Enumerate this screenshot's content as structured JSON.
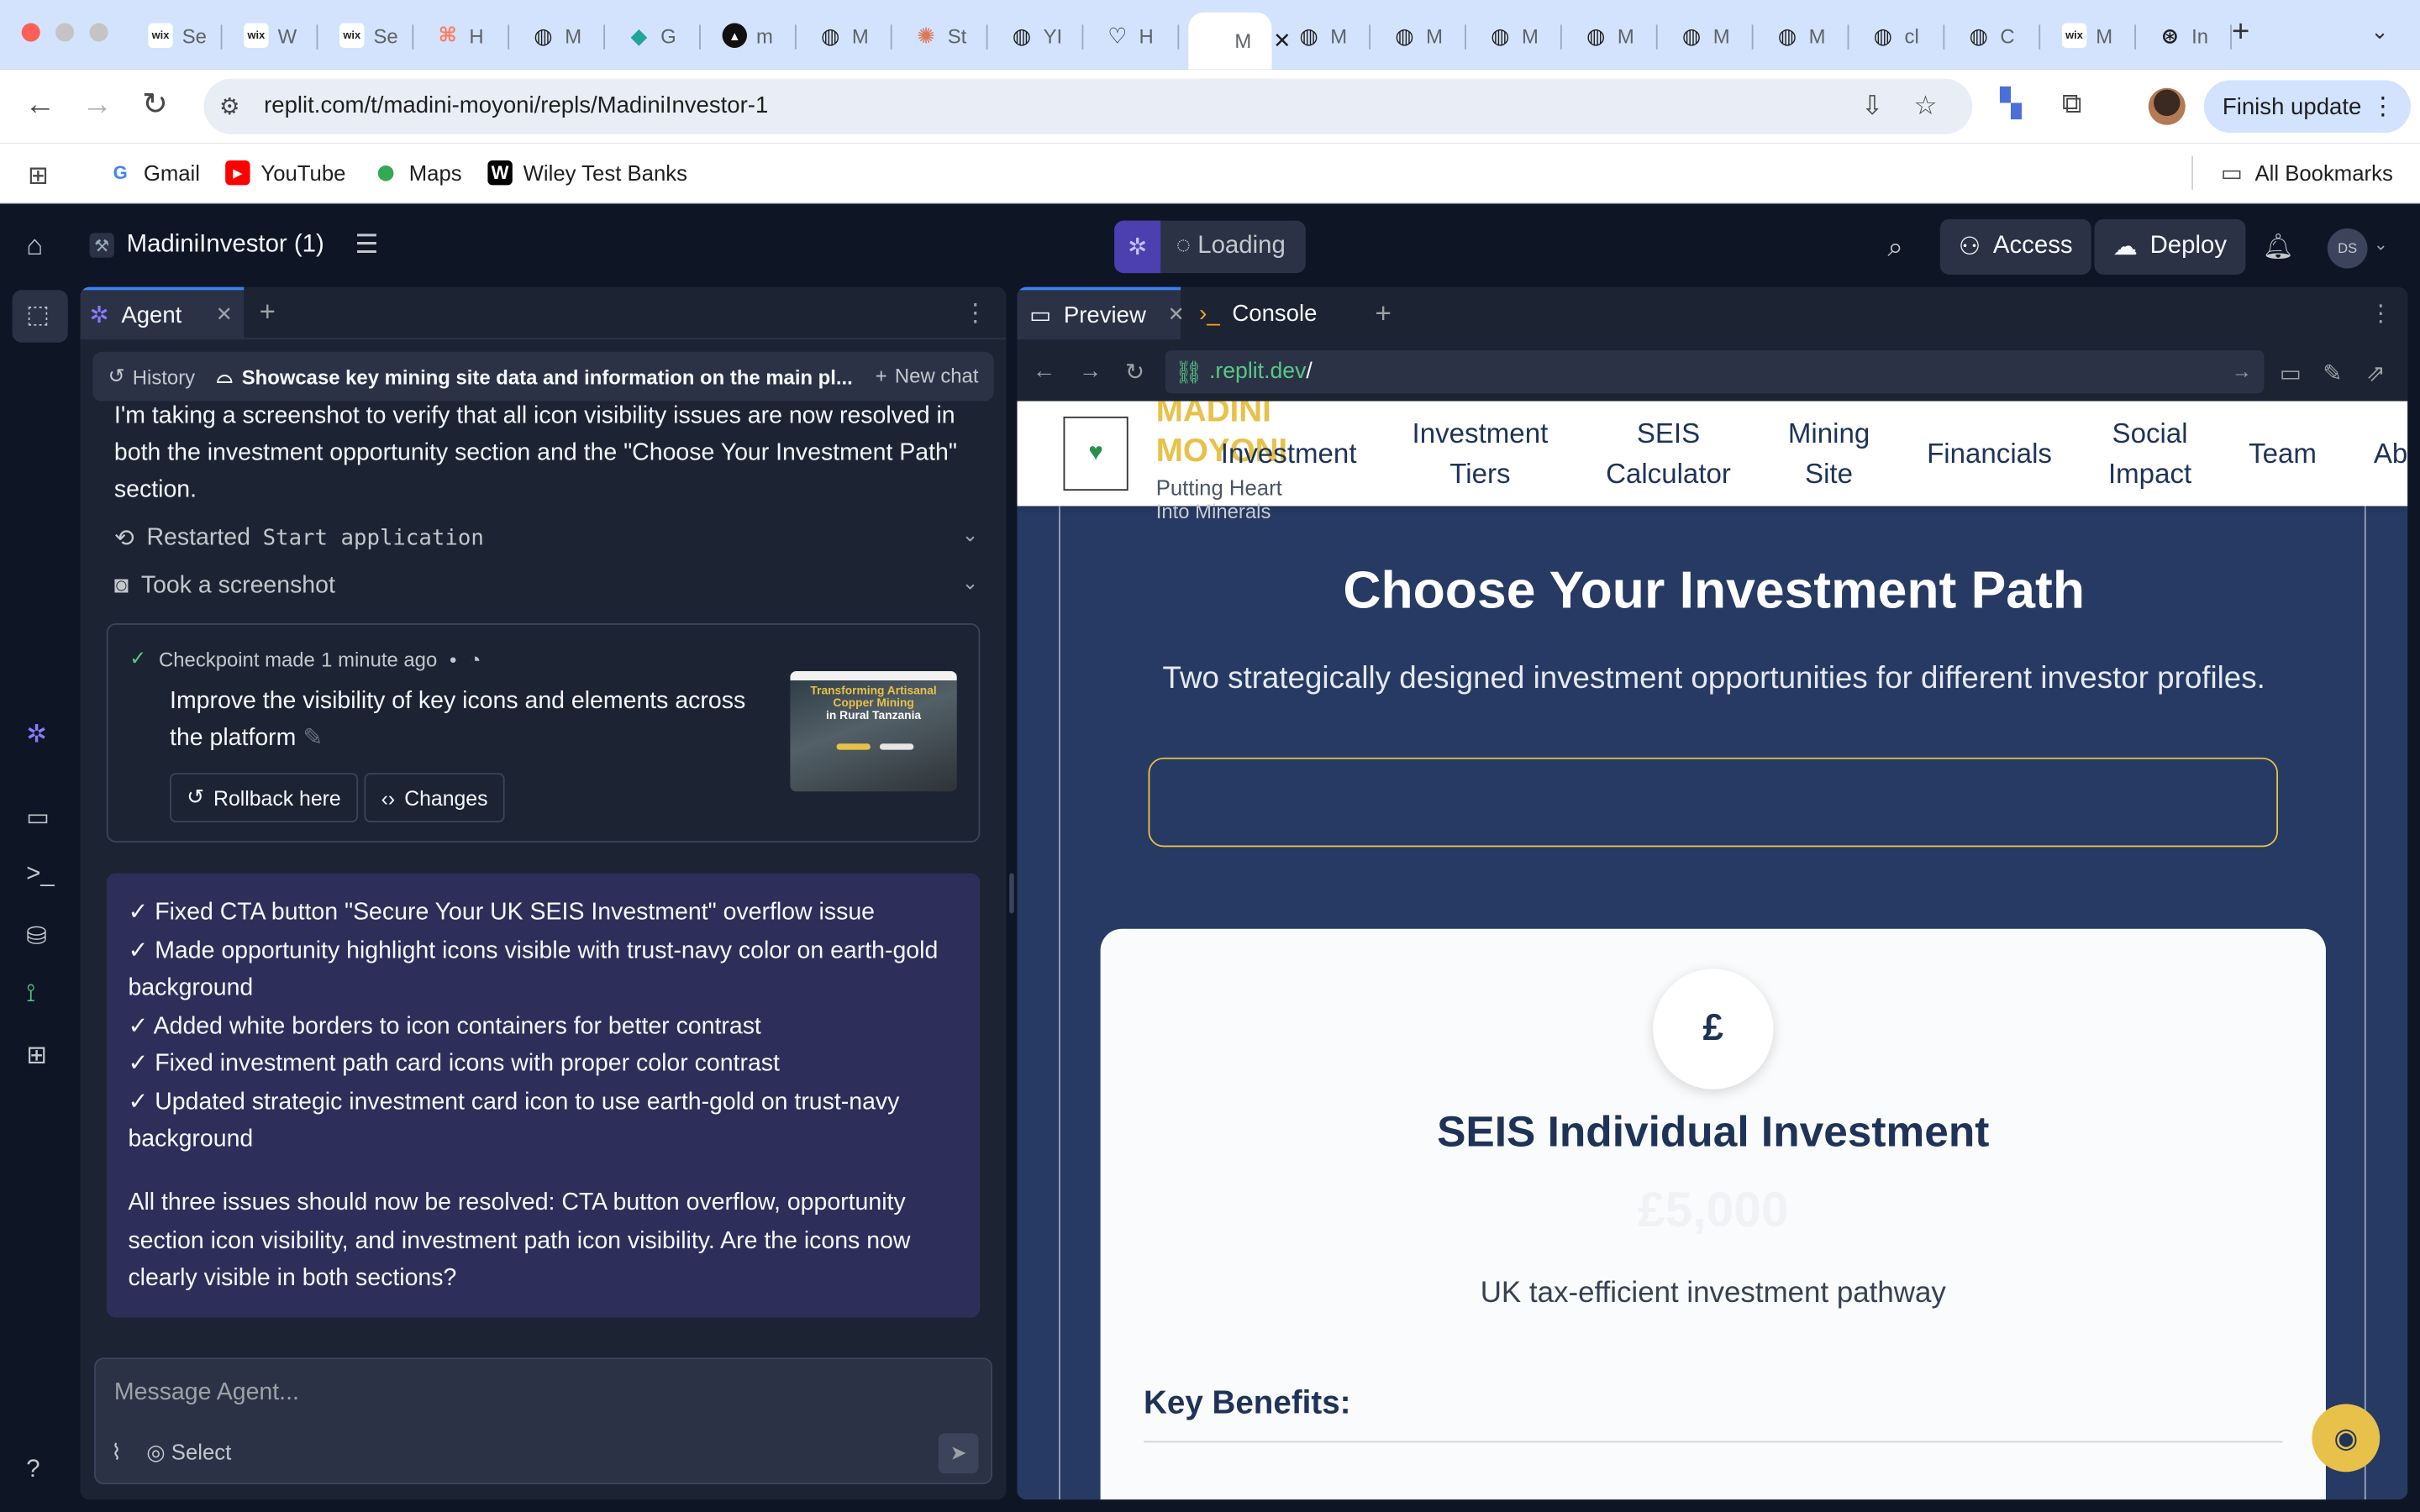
{
  "browser": {
    "tabs": [
      {
        "short": "Se",
        "icon": "wix-icon",
        "glyph": "wix"
      },
      {
        "short": "W",
        "icon": "wix-icon",
        "glyph": "wix"
      },
      {
        "short": "Se",
        "icon": "wix-icon",
        "glyph": "wix"
      },
      {
        "short": "H",
        "icon": "hubspot-icon",
        "glyph": "⌘"
      },
      {
        "short": "M",
        "icon": "globe-icon",
        "glyph": "◍"
      },
      {
        "short": "G",
        "icon": "diamond-icon",
        "glyph": "◆"
      },
      {
        "short": "m",
        "icon": "triangle-icon",
        "glyph": "▲"
      },
      {
        "short": "M",
        "icon": "globe-icon",
        "glyph": "◍"
      },
      {
        "short": "St",
        "icon": "sunburst-icon",
        "glyph": "✺"
      },
      {
        "short": "YI",
        "icon": "globe-icon",
        "glyph": "◍"
      },
      {
        "short": "H",
        "icon": "heart-hands-icon",
        "glyph": "♡"
      },
      {
        "short": "M",
        "icon": "replit-icon",
        "glyph": ""
      },
      {
        "short": "M",
        "icon": "globe-icon",
        "glyph": "◍"
      },
      {
        "short": "M",
        "icon": "globe-icon",
        "glyph": "◍"
      },
      {
        "short": "M",
        "icon": "globe-icon",
        "glyph": "◍"
      },
      {
        "short": "M",
        "icon": "globe-icon",
        "glyph": "◍"
      },
      {
        "short": "M",
        "icon": "globe-icon",
        "glyph": "◍"
      },
      {
        "short": "M",
        "icon": "globe-icon",
        "glyph": "◍"
      },
      {
        "short": "cl",
        "icon": "globe-icon",
        "glyph": "◍"
      },
      {
        "short": "C",
        "icon": "globe-icon",
        "glyph": "◍"
      },
      {
        "short": "M",
        "icon": "wix-icon",
        "glyph": "wix"
      },
      {
        "short": "In",
        "icon": "openai-icon",
        "glyph": "⊛"
      }
    ],
    "active_tab_index": 11,
    "url": "replit.com/t/madini-moyoni/repls/MadiniInvestor-1",
    "finish_update": "Finish update",
    "bookmarks": [
      {
        "label": "Gmail",
        "icon": "google-icon",
        "glyph": "G",
        "color": "#4285f4"
      },
      {
        "label": "YouTube",
        "icon": "youtube-icon",
        "glyph": "▶",
        "color": "#ff0000"
      },
      {
        "label": "Maps",
        "icon": "maps-pin-icon",
        "glyph": "⬤",
        "color": "#34a853"
      },
      {
        "label": "Wiley Test Banks",
        "icon": "wiley-icon",
        "glyph": "W",
        "color": "#000000"
      }
    ],
    "all_bookmarks": "All Bookmarks"
  },
  "replit": {
    "project_name": "MadiniInvestor (1)",
    "loading": "Loading",
    "access": "Access",
    "deploy": "Deploy",
    "avatar_initials": "DS",
    "agent_tab": "Agent",
    "history": "History",
    "chat_title": "Showcase key mining site data and information on the main pl...",
    "new_chat": "New chat",
    "intro_text": "I'm taking a screenshot to verify that all icon visibility issues are now resolved in both the investment opportunity section and the \"Choose Your Investment Path\" section.",
    "action1_prefix": "Restarted",
    "action1_code": "Start application",
    "action2": "Took a screenshot",
    "checkpoint_prefix": "Checkpoint made",
    "checkpoint_time": "1 minute ago",
    "checkpoint_title": "Improve the visibility of key icons and elements across the platform",
    "rollback": "Rollback here",
    "changes": "Changes",
    "thumb_line1": "Transforming Artisanal",
    "thumb_line2": "Copper Mining",
    "thumb_line3": "in Rural Tanzania",
    "summary_items": [
      "✓ Fixed CTA button \"Secure Your UK SEIS Investment\" overflow issue",
      "✓ Made opportunity highlight icons visible with trust-navy color on earth-gold background",
      "✓ Added white borders to icon containers for better contrast",
      "✓ Fixed investment path card icons with proper color contrast",
      "✓ Updated strategic investment card icon to use earth-gold on trust-navy background"
    ],
    "summary_paragraph": "All three issues should now be resolved: CTA button overflow, opportunity section icon visibility, and investment path icon visibility. Are the icons now clearly visible in both sections?",
    "composer_placeholder": "Message Agent...",
    "select": "Select",
    "preview_tab": "Preview",
    "console_tab": "Console",
    "preview_url_domain": ".replit.dev",
    "preview_url_path": "/"
  },
  "site": {
    "brand": "MADINI MOYONI",
    "tagline": "Putting Heart",
    "tagline2": "Into Minerals",
    "nav": [
      "Investment",
      "Investment Tiers",
      "SEIS Calculator",
      "Mining Site",
      "Financials",
      "Social Impact",
      "Team",
      "Ab"
    ],
    "section_title": "Choose Your Investment Path",
    "section_subtitle": "Two strategically designed investment opportunities for different investor profiles.",
    "card_icon": "£",
    "card_title": "SEIS Individual Investment",
    "card_ghost": "£5,000",
    "card_desc": "UK tax-efficient investment pathway",
    "key_benefits": "Key Benefits:"
  },
  "colors": {
    "replit_bg": "#0e1525",
    "panel_bg": "#1c2333",
    "summary_bg": "#2d2f5a",
    "earth_gold": "#e8c14a",
    "trust_navy": "#1f3358",
    "site_bg": "#263a63"
  }
}
